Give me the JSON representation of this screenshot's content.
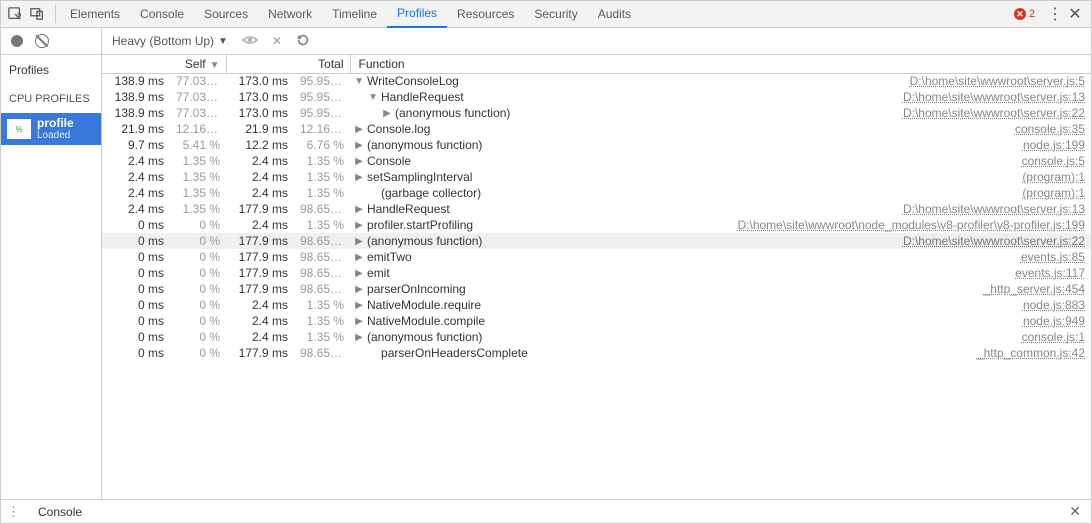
{
  "tabs": {
    "items": [
      "Elements",
      "Console",
      "Sources",
      "Network",
      "Timeline",
      "Profiles",
      "Resources",
      "Security",
      "Audits"
    ],
    "active": "Profiles"
  },
  "errors": {
    "count": "2"
  },
  "sidebar": {
    "heading": "Profiles",
    "section": "CPU PROFILES",
    "profile": {
      "name": "profile",
      "status": "Loaded"
    }
  },
  "profile_toolbar": {
    "view": "Heavy (Bottom Up)"
  },
  "columns": {
    "self": "Self",
    "total": "Total",
    "function": "Function"
  },
  "rows": [
    {
      "self_ms": "138.9 ms",
      "self_pct": "77.03 %",
      "tot_ms": "173.0 ms",
      "tot_pct": "95.95 %",
      "indent": 0,
      "arrow": "down",
      "fn": "WriteConsoleLog",
      "src": "D:\\home\\site\\wwwroot\\server.js:5"
    },
    {
      "self_ms": "138.9 ms",
      "self_pct": "77.03 %",
      "tot_ms": "173.0 ms",
      "tot_pct": "95.95 %",
      "indent": 1,
      "arrow": "down",
      "fn": "HandleRequest",
      "src": "D:\\home\\site\\wwwroot\\server.js:13"
    },
    {
      "self_ms": "138.9 ms",
      "self_pct": "77.03 %",
      "tot_ms": "173.0 ms",
      "tot_pct": "95.95 %",
      "indent": 2,
      "arrow": "right",
      "fn": "(anonymous function)",
      "src": "D:\\home\\site\\wwwroot\\server.js:22"
    },
    {
      "self_ms": "21.9 ms",
      "self_pct": "12.16 %",
      "tot_ms": "21.9 ms",
      "tot_pct": "12.16 %",
      "indent": 0,
      "arrow": "right",
      "fn": "Console.log",
      "src": "console.js:35"
    },
    {
      "self_ms": "9.7 ms",
      "self_pct": "5.41 %",
      "tot_ms": "12.2 ms",
      "tot_pct": "6.76 %",
      "indent": 0,
      "arrow": "right",
      "fn": "(anonymous function)",
      "src": "node.js:199"
    },
    {
      "self_ms": "2.4 ms",
      "self_pct": "1.35 %",
      "tot_ms": "2.4 ms",
      "tot_pct": "1.35 %",
      "indent": 0,
      "arrow": "right",
      "fn": "Console",
      "src": "console.js:5"
    },
    {
      "self_ms": "2.4 ms",
      "self_pct": "1.35 %",
      "tot_ms": "2.4 ms",
      "tot_pct": "1.35 %",
      "indent": 0,
      "arrow": "right",
      "fn": "setSamplingInterval",
      "src": "(program):1"
    },
    {
      "self_ms": "2.4 ms",
      "self_pct": "1.35 %",
      "tot_ms": "2.4 ms",
      "tot_pct": "1.35 %",
      "indent": 1,
      "arrow": "none",
      "fn": "(garbage collector)",
      "src": "(program):1"
    },
    {
      "self_ms": "2.4 ms",
      "self_pct": "1.35 %",
      "tot_ms": "177.9 ms",
      "tot_pct": "98.65 %",
      "indent": 0,
      "arrow": "right",
      "fn": "HandleRequest",
      "src": "D:\\home\\site\\wwwroot\\server.js:13"
    },
    {
      "self_ms": "0 ms",
      "self_pct": "0 %",
      "tot_ms": "2.4 ms",
      "tot_pct": "1.35 %",
      "indent": 0,
      "arrow": "right",
      "fn": "profiler.startProfiling",
      "src": "D:\\home\\site\\wwwroot\\node_modules\\v8-profiler\\v8-profiler.js:199"
    },
    {
      "self_ms": "0 ms",
      "self_pct": "0 %",
      "tot_ms": "177.9 ms",
      "tot_pct": "98.65 %",
      "indent": 0,
      "arrow": "right",
      "fn": "(anonymous function)",
      "src": "D:\\home\\site\\wwwroot\\server.js:22",
      "selected": true
    },
    {
      "self_ms": "0 ms",
      "self_pct": "0 %",
      "tot_ms": "177.9 ms",
      "tot_pct": "98.65 %",
      "indent": 0,
      "arrow": "right",
      "fn": "emitTwo",
      "src": "events.js:85"
    },
    {
      "self_ms": "0 ms",
      "self_pct": "0 %",
      "tot_ms": "177.9 ms",
      "tot_pct": "98.65 %",
      "indent": 0,
      "arrow": "right",
      "fn": "emit",
      "src": "events.js:117"
    },
    {
      "self_ms": "0 ms",
      "self_pct": "0 %",
      "tot_ms": "177.9 ms",
      "tot_pct": "98.65 %",
      "indent": 0,
      "arrow": "right",
      "fn": "parserOnIncoming",
      "src": "_http_server.js:454"
    },
    {
      "self_ms": "0 ms",
      "self_pct": "0 %",
      "tot_ms": "2.4 ms",
      "tot_pct": "1.35 %",
      "indent": 0,
      "arrow": "right",
      "fn": "NativeModule.require",
      "src": "node.js:883"
    },
    {
      "self_ms": "0 ms",
      "self_pct": "0 %",
      "tot_ms": "2.4 ms",
      "tot_pct": "1.35 %",
      "indent": 0,
      "arrow": "right",
      "fn": "NativeModule.compile",
      "src": "node.js:949"
    },
    {
      "self_ms": "0 ms",
      "self_pct": "0 %",
      "tot_ms": "2.4 ms",
      "tot_pct": "1.35 %",
      "indent": 0,
      "arrow": "right",
      "fn": "(anonymous function)",
      "src": "console.js:1"
    },
    {
      "self_ms": "0 ms",
      "self_pct": "0 %",
      "tot_ms": "177.9 ms",
      "tot_pct": "98.65 %",
      "indent": 1,
      "arrow": "none",
      "fn": "parserOnHeadersComplete",
      "src": "_http_common.js:42"
    }
  ],
  "drawer": {
    "tab": "Console"
  }
}
